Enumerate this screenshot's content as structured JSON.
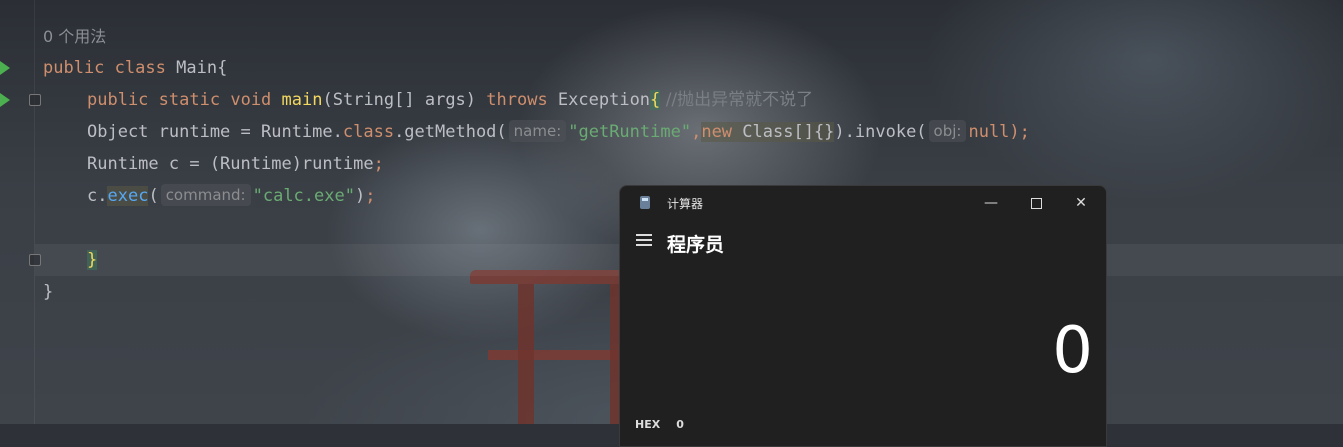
{
  "editor": {
    "usage_hint": "0 个用法",
    "code": {
      "l1_kw1": "public",
      "l1_kw2": "class",
      "l1_name": "Main",
      "l1_brace": "{",
      "l2_kw1": "public",
      "l2_kw2": "static",
      "l2_kw3": "void",
      "l2_method": "main",
      "l2_params": "(String[] args) ",
      "l2_throws": "throws",
      "l2_exc": " Exception",
      "l2_brace": "{",
      "l2_comment": " //抛出异常就不说了",
      "l3_a": "Object runtime = Runtime.",
      "l3_class": "class",
      "l3_b": ".getMethod(",
      "l3_hint": "name:",
      "l3_str": "\"getRuntime\"",
      "l3_comma": ",",
      "l3_new": "new",
      "l3_c": " Class[]",
      "l3_braces": "{}",
      "l3_d": ").invoke(",
      "l3_hint2": "obj:",
      "l3_null": "null",
      "l3_end": ");",
      "l4_a": "Runtime c = (Runtime)runtime",
      "l4_semi": ";",
      "l5_a": "c.",
      "l5_method": "exec",
      "l5_b": "(",
      "l5_hint": "command:",
      "l5_str": "\"calc.exe\"",
      "l5_c": ")",
      "l5_semi": ";",
      "l7_brace": "}",
      "l8_brace": "}"
    }
  },
  "calculator": {
    "title": "计算器",
    "mode": "程序员",
    "display_value": "0",
    "min_icon": "—",
    "close_icon": "✕",
    "hex_label": "HEX",
    "hex_value": "0"
  }
}
